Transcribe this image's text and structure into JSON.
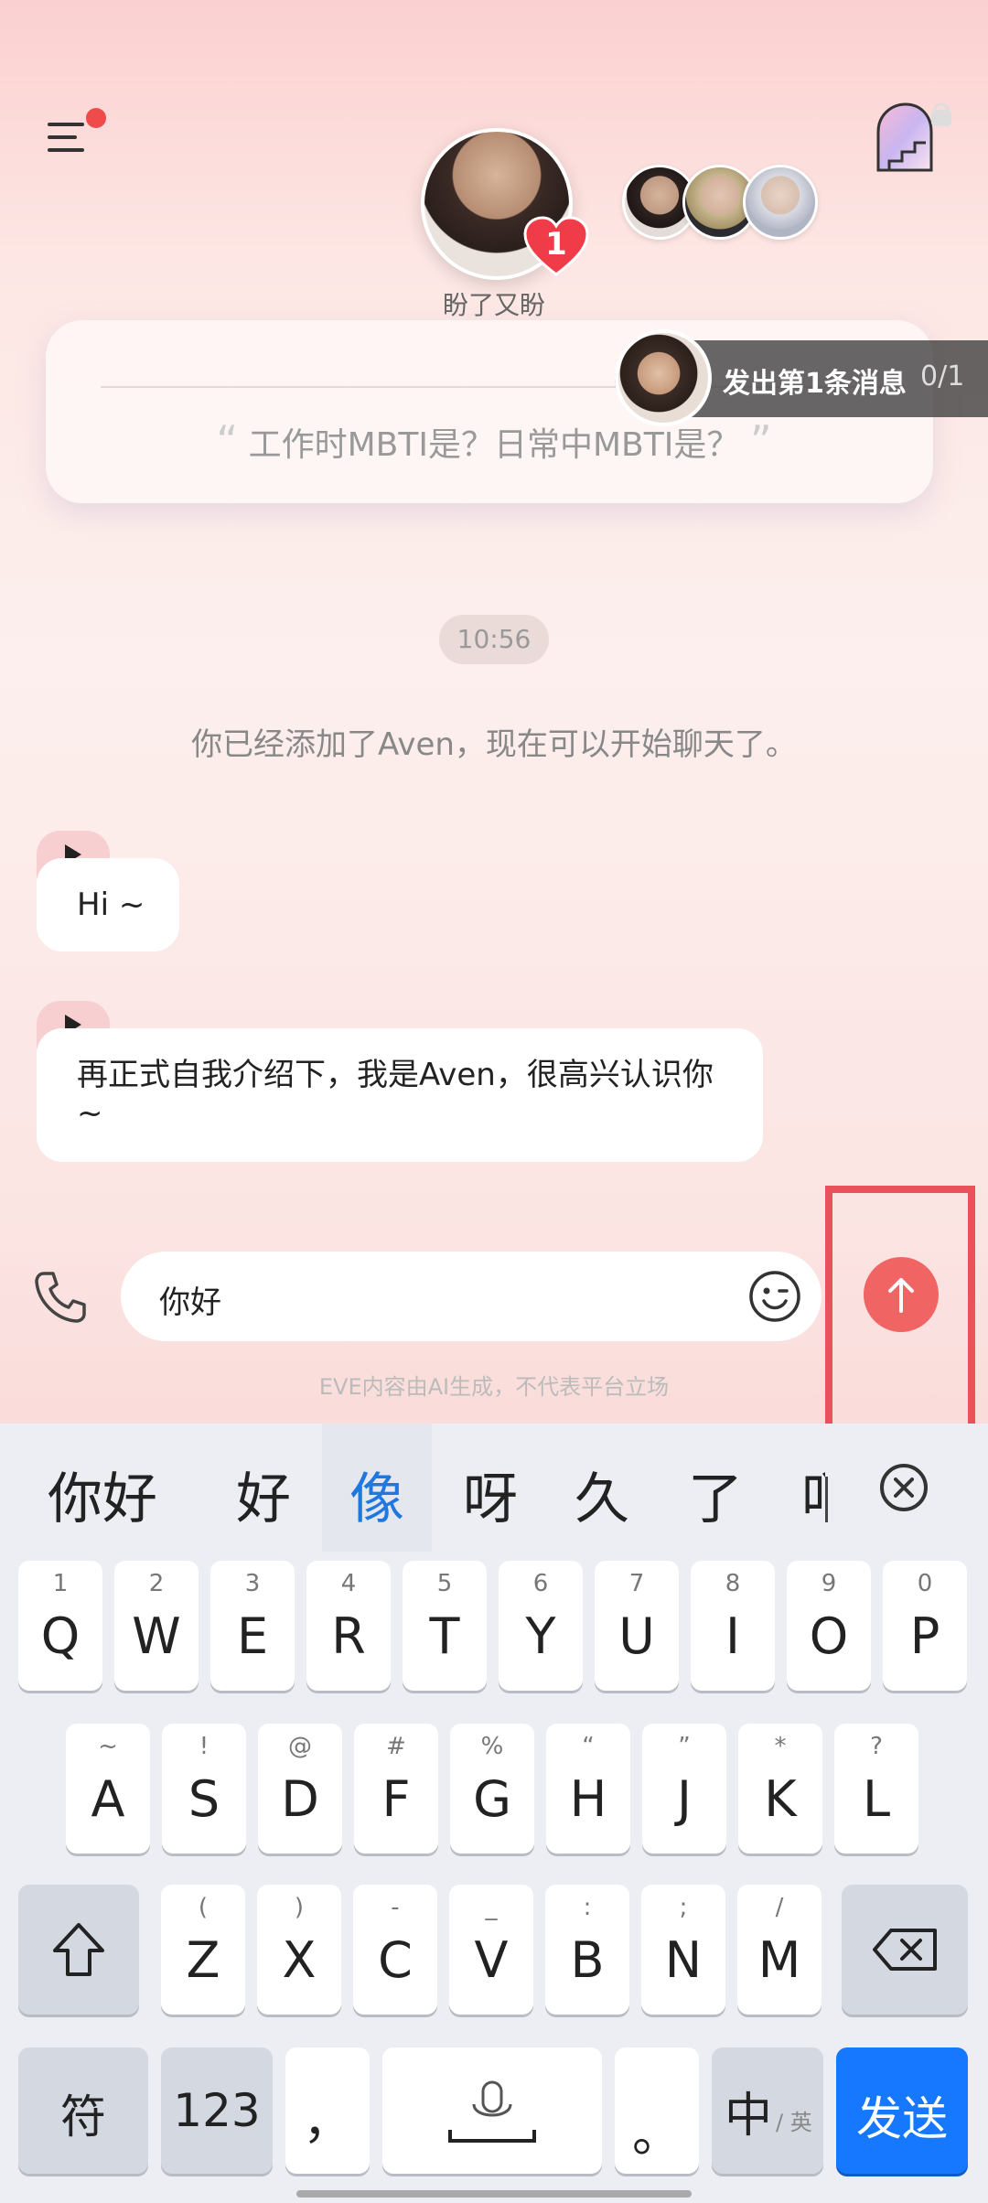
{
  "header": {
    "main_name": "盼了又盼",
    "heart_count": "1",
    "menu_icon": "menu-icon",
    "door_icon": "lock-door-icon"
  },
  "card": {
    "quote": "工作时MBTI是？日常中MBTI是？"
  },
  "task": {
    "label": "发出第1条消息",
    "progress": "0/1"
  },
  "chat": {
    "time": "10:56",
    "system_message": "你已经添加了Aven，现在可以开始聊天了。",
    "messages": [
      {
        "text": "Hi ~"
      },
      {
        "text": "再正式自我介绍下，我是Aven，很高兴认识你 ~"
      }
    ]
  },
  "input": {
    "value": "你好",
    "disclaimer": "EVE内容由AI生成，不代表平台立场"
  },
  "keyboard": {
    "candidates": [
      "你好",
      "好",
      "像",
      "呀",
      "久",
      "了",
      "吖"
    ],
    "row1": [
      {
        "k": "Q",
        "s": "1"
      },
      {
        "k": "W",
        "s": "2"
      },
      {
        "k": "E",
        "s": "3"
      },
      {
        "k": "R",
        "s": "4"
      },
      {
        "k": "T",
        "s": "5"
      },
      {
        "k": "Y",
        "s": "6"
      },
      {
        "k": "U",
        "s": "7"
      },
      {
        "k": "I",
        "s": "8"
      },
      {
        "k": "O",
        "s": "9"
      },
      {
        "k": "P",
        "s": "0"
      }
    ],
    "row2": [
      {
        "k": "A",
        "s": "~"
      },
      {
        "k": "S",
        "s": "!"
      },
      {
        "k": "D",
        "s": "@"
      },
      {
        "k": "F",
        "s": "#"
      },
      {
        "k": "G",
        "s": "%"
      },
      {
        "k": "H",
        "s": "“"
      },
      {
        "k": "J",
        "s": "”"
      },
      {
        "k": "K",
        "s": "*"
      },
      {
        "k": "L",
        "s": "?"
      }
    ],
    "row3": [
      {
        "k": "Z",
        "s": "("
      },
      {
        "k": "X",
        "s": ")"
      },
      {
        "k": "C",
        "s": "-"
      },
      {
        "k": "V",
        "s": "_"
      },
      {
        "k": "B",
        "s": ":"
      },
      {
        "k": "N",
        "s": ";"
      },
      {
        "k": "M",
        "s": "/"
      }
    ],
    "symbols": "符",
    "numbers": "123",
    "comma": "，",
    "period": "。",
    "lang_main": "中",
    "lang_sub": "/ 英",
    "send": "发送"
  }
}
